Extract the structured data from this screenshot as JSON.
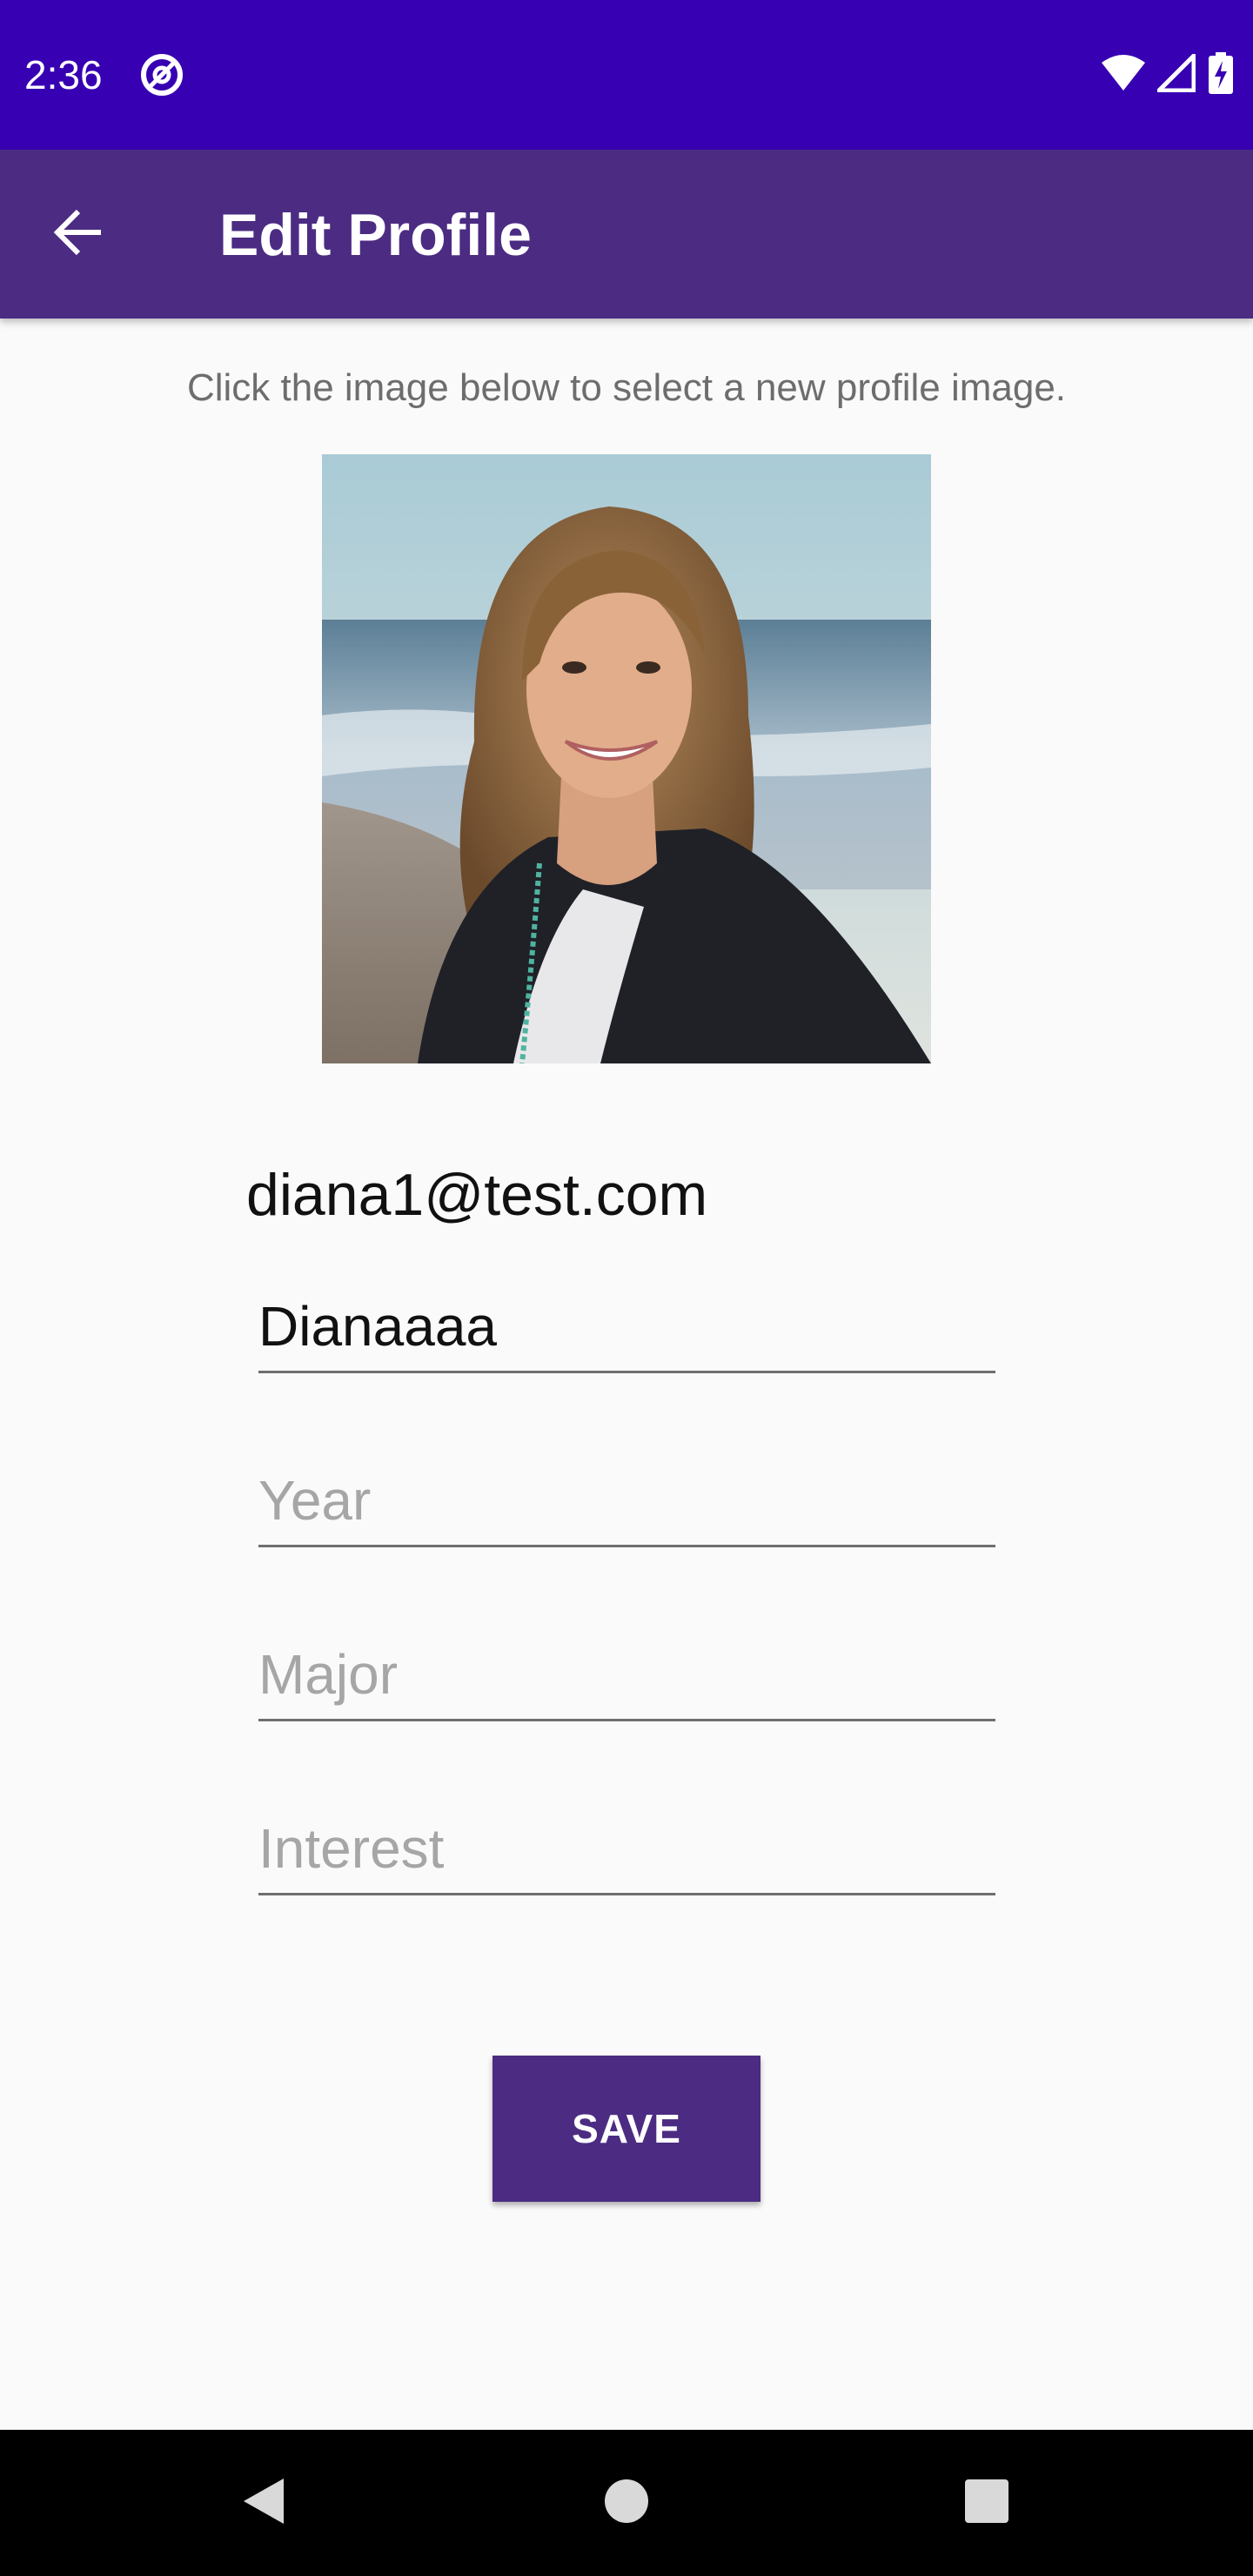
{
  "status_bar": {
    "time": "2:36",
    "app_icon": "at-sign-icon",
    "icons": [
      "wifi-icon",
      "signal-icon",
      "battery-charging-icon"
    ]
  },
  "app_bar": {
    "back_icon": "arrow-back-icon",
    "title": "Edit Profile"
  },
  "hint": "Click the image below to select a new profile image.",
  "profile": {
    "image_icon": "profile-photo",
    "email": "diana1@test.com"
  },
  "form": {
    "name_value": "Dianaaaa",
    "name_placeholder": "",
    "year_value": "",
    "year_placeholder": "Year",
    "major_value": "",
    "major_placeholder": "Major",
    "interest_value": "",
    "interest_placeholder": "Interest",
    "save_label": "SAVE"
  },
  "nav_bar": {
    "back": "triangle-back-icon",
    "home": "circle-home-icon",
    "recents": "square-recents-icon"
  },
  "colors": {
    "status_bar": "#3700b3",
    "app_bar": "#4b2c82",
    "button": "#4b2c82",
    "background": "#fafafa"
  }
}
